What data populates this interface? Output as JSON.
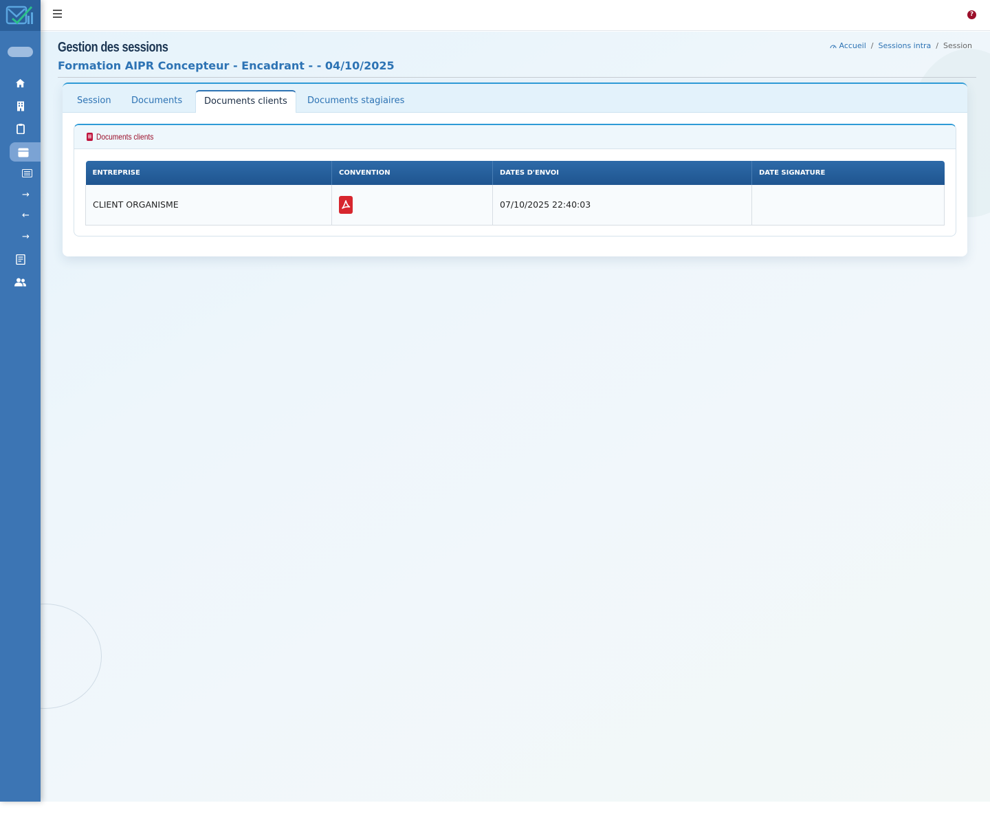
{
  "topbar": {
    "menu_icon": "hamburger-icon",
    "help_label": "?"
  },
  "sidebar": {
    "items": [
      {
        "name": "home",
        "icon": "home-icon",
        "glyph": "⌂"
      },
      {
        "name": "building",
        "icon": "building-icon",
        "glyph": "▦"
      },
      {
        "name": "clipboard",
        "icon": "clipboard-icon",
        "glyph": "▯"
      },
      {
        "name": "calendar",
        "icon": "calendar-icon",
        "glyph": "▭",
        "active": true
      },
      {
        "name": "list",
        "icon": "list-icon",
        "glyph": "☰"
      },
      {
        "name": "arrow-right",
        "icon": "arrow-right-icon",
        "glyph": "→"
      },
      {
        "name": "arrow-left",
        "icon": "arrow-left-icon",
        "glyph": "←"
      },
      {
        "name": "arrow-right-2",
        "icon": "arrow-right-icon",
        "glyph": "→"
      },
      {
        "name": "document",
        "icon": "document-icon",
        "glyph": "▤"
      },
      {
        "name": "users",
        "icon": "users-icon",
        "glyph": "👥"
      }
    ]
  },
  "header": {
    "title": "Gestion des sessions",
    "subtitle": "Formation AIPR Concepteur - Encadrant - - 04/10/2025",
    "breadcrumb": {
      "home": "Accueil",
      "sep": "/",
      "section": "Sessions intra",
      "current": "Session"
    }
  },
  "tabs": [
    {
      "label": "Session",
      "active": false
    },
    {
      "label": "Documents",
      "active": false
    },
    {
      "label": "Documents clients",
      "active": true
    },
    {
      "label": "Documents stagiaires",
      "active": false
    }
  ],
  "panel": {
    "title": "Documents clients",
    "columns": [
      "ENTREPRISE",
      "CONVENTION",
      "DATES D'ENVOI",
      "DATE SIGNATURE"
    ],
    "rows": [
      {
        "entreprise": "CLIENT ORGANISME",
        "convention_icon": "pdf-icon",
        "dates_envoi": "07/10/2025 22:40:03",
        "date_signature": ""
      }
    ]
  },
  "colors": {
    "sidebar": "#3c75b4",
    "accent": "#2d73b4",
    "table_header": "#1f5590",
    "danger": "#9b0f2a",
    "pdf": "#d7262e"
  }
}
